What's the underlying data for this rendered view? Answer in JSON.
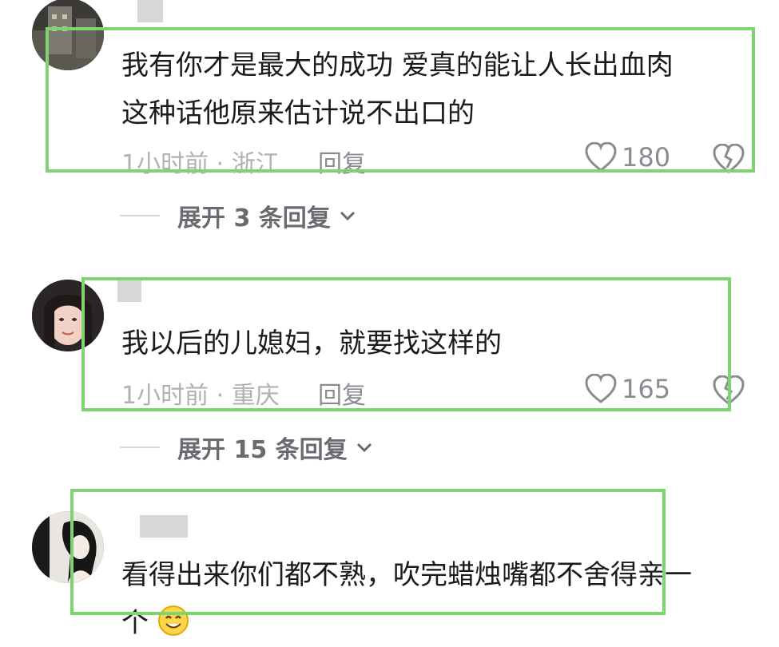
{
  "comments": [
    {
      "text_lines": [
        "我有你才是最大的成功  爱真的能让人长出血肉",
        "这种话他原来估计说不出口的"
      ],
      "meta": "1小时前 · 浙江",
      "reply_label": "回复",
      "likes": "180",
      "expand_label": "展开 3 条回复"
    },
    {
      "text_lines": [
        "我以后的儿媳妇，就要找这样的"
      ],
      "meta": "1小时前 · 重庆",
      "reply_label": "回复",
      "likes": "165",
      "expand_label": "展开 15 条回复"
    },
    {
      "text_lines": [
        "看得出来你们都不熟，吹完蜡烛嘴都不舍得亲一",
        "个"
      ],
      "emoji": "smile-emoji"
    }
  ],
  "icons": {
    "like": "heart-outline-icon",
    "dislike": "broken-heart-icon",
    "expand": "chevron-down-icon"
  },
  "colors": {
    "highlight_border": "#7ed56f",
    "meta_text": "#b0b0b6",
    "body_text": "#1b1b1f"
  }
}
